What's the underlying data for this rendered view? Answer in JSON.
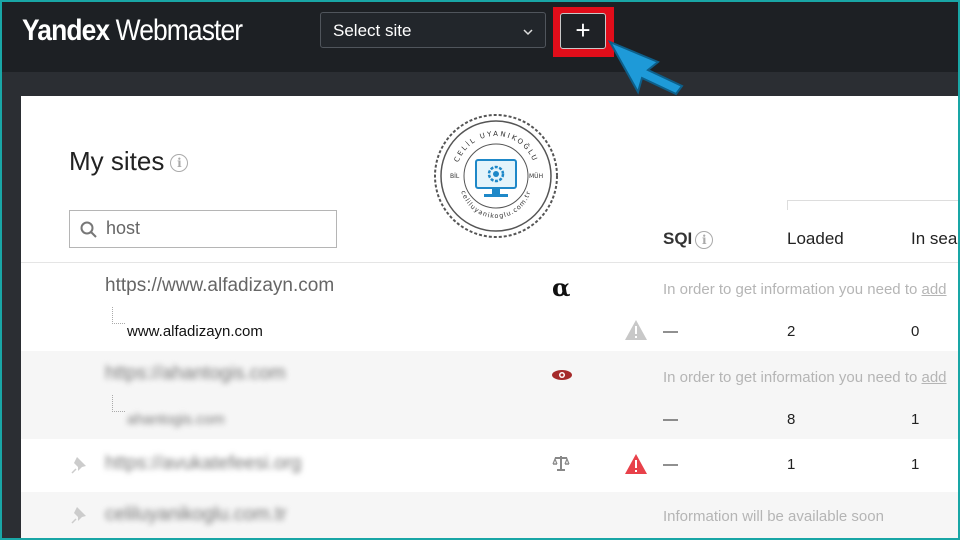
{
  "app": {
    "logo_brand": "Yandex",
    "logo_product": "Webmaster"
  },
  "header": {
    "select_site": "Select site",
    "add_button": "+"
  },
  "page": {
    "title": "My sites"
  },
  "search": {
    "value": "host"
  },
  "columns": {
    "sqi": "SQI",
    "loaded": "Loaded",
    "in_search": "In sea"
  },
  "stamp": {
    "top_text": "CELİL UYANIKOĞLU",
    "bottom_text": "celiluyanikoglu.com.tr",
    "left": "BİL",
    "right": "MÜH"
  },
  "rows": [
    {
      "host": "https://www.alfadizayn.com",
      "note": "In order to get information you need to",
      "note_link": "add",
      "sub": "www.alfadizayn.com",
      "sqi": "—",
      "loaded": "2",
      "in_search": "0"
    },
    {
      "host": "https://ahantogis.com",
      "note": "In order to get information you need to",
      "note_link": "add",
      "sub": "ahantogis.com",
      "sqi": "—",
      "loaded": "8",
      "in_search": "1"
    },
    {
      "host": "https://avukatefeesi.org",
      "sqi": "—",
      "loaded": "1",
      "in_search": "1"
    },
    {
      "host": "celiluyanikoglu.com.tr",
      "note": "Information will be available soon"
    }
  ],
  "colors": {
    "accent_red": "#e10d1a",
    "frame": "#19a6a6",
    "cursor": "#1e9ad8"
  }
}
